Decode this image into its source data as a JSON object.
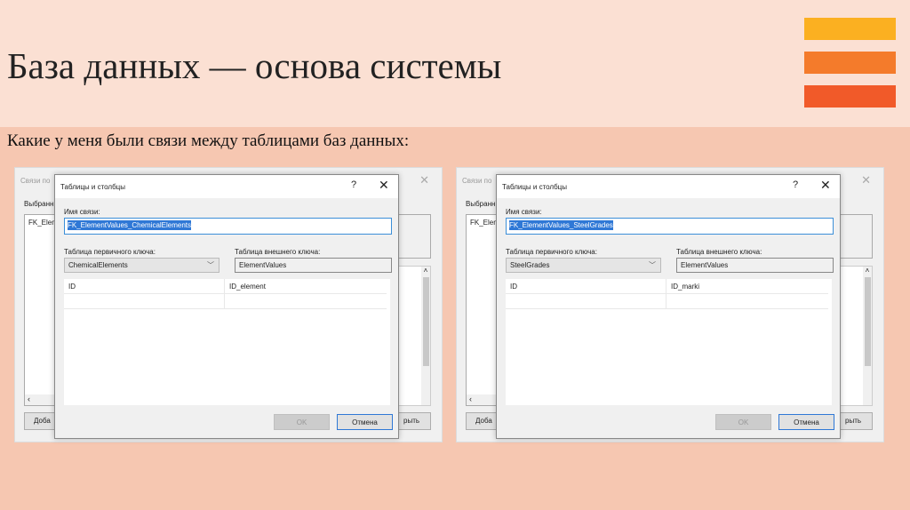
{
  "slide": {
    "title": "База данных — основа системы",
    "subtitle": "Какие у меня были связи между таблицами баз данных:"
  },
  "colors": {
    "bar1": "#fbb021",
    "bar2": "#f47b2b",
    "bar3": "#f15a29"
  },
  "windows": [
    {
      "backdrop_title": "Связи по",
      "selected_label": "Выбранн",
      "list_item": "FK_Elem",
      "add_button": "Доба",
      "close_button": "рыть",
      "dialog": {
        "title": "Таблицы и столбцы",
        "help": "?",
        "close": "✕",
        "name_label": "Имя связи:",
        "name_value": "FK_ElementValues_ChemicalElements",
        "pk_label": "Таблица первичного ключа:",
        "fk_label": "Таблица внешнего ключа:",
        "pk_table": "ChemicalElements",
        "fk_table": "ElementValues",
        "pk_column": "ID",
        "fk_column": "ID_element",
        "ok": "OK",
        "cancel": "Отмена"
      }
    },
    {
      "backdrop_title": "Связи по",
      "selected_label": "Выбранн",
      "list_item": "FK_Elem",
      "add_button": "Доба",
      "close_button": "рыть",
      "dialog": {
        "title": "Таблицы и столбцы",
        "help": "?",
        "close": "✕",
        "name_label": "Имя связи:",
        "name_value": "FK_ElementValues_SteelGrades",
        "pk_label": "Таблица первичного ключа:",
        "fk_label": "Таблица внешнего ключа:",
        "pk_table": "SteelGrades",
        "fk_table": "ElementValues",
        "pk_column": "ID",
        "fk_column": "ID_marki",
        "ok": "OK",
        "cancel": "Отмена"
      }
    }
  ]
}
